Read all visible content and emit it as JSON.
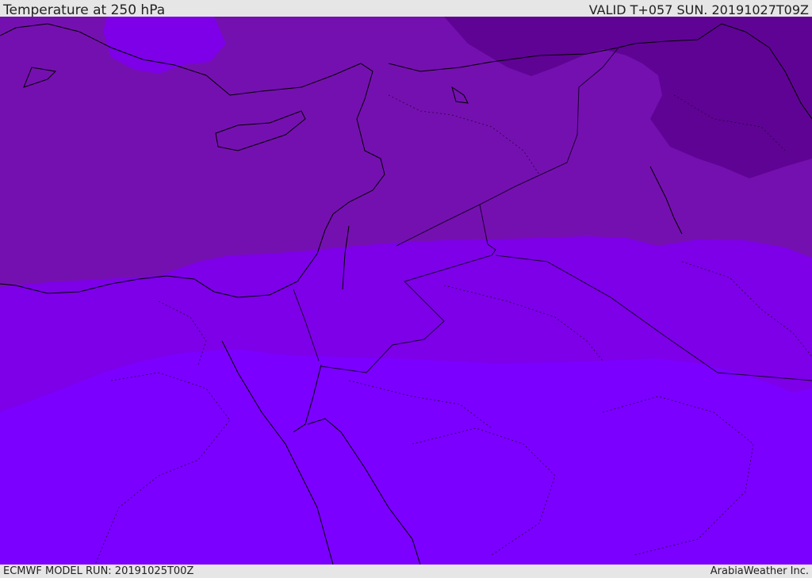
{
  "header": {
    "title": "Temperature at 250 hPa",
    "valid": "VALID T+057 SUN. 20191027T09Z"
  },
  "footer": {
    "model_run": "ECMWF MODEL RUN: 20191025T00Z",
    "credit": "ArabiaWeather Inc."
  },
  "colors": {
    "band_cold": "#5f0394",
    "band_cool": "#7510b0",
    "band_mid": "#7d00e8",
    "band_warm": "#7b00ff",
    "coastline": "#000000",
    "border": "#1a0030"
  }
}
